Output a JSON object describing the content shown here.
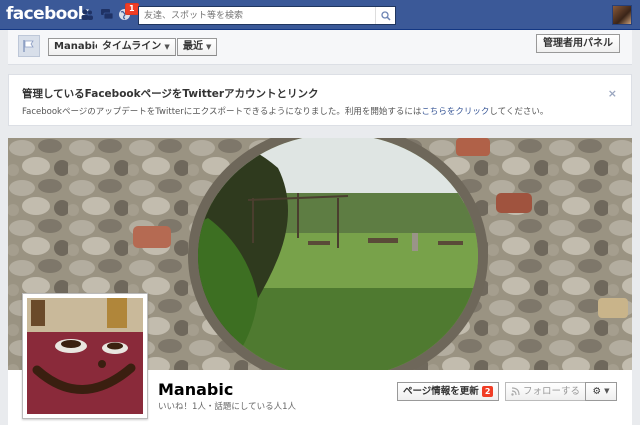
{
  "topbar": {
    "logo": "facebook",
    "notification_count": "1",
    "search_placeholder": "友達、スポット等を検索"
  },
  "admin_bar": {
    "page_name_crumb": "Manabic",
    "timeline_crumb": "タイムライン",
    "recent_crumb": "最近",
    "admin_panel_label": "管理者用パネル"
  },
  "notice": {
    "title": "管理しているFacebookページをTwitterアカウントとリンク",
    "body_prefix": "FacebookページのアップデートをTwitterにエクスポートできるようになりました。利用を開始するには",
    "body_link": "こちらをクリック",
    "body_suffix": "してください。",
    "close": "×"
  },
  "profile": {
    "name": "Manabic",
    "stats": "いいね！1人・話題にしている人1人",
    "update_button_label": "ページ情報を更新",
    "update_badge": "2",
    "follow_button_label": "フォローする",
    "gear_label": "⚙"
  },
  "icons": [
    "friend-requests-icon",
    "messages-icon",
    "notifications-globe-icon",
    "search-icon",
    "page-flag-icon",
    "rss-icon",
    "gear-icon",
    "close-icon"
  ],
  "colors": {
    "brand_blue": "#3b5998",
    "badge_red": "#f03d25",
    "link": "#3b5998"
  }
}
